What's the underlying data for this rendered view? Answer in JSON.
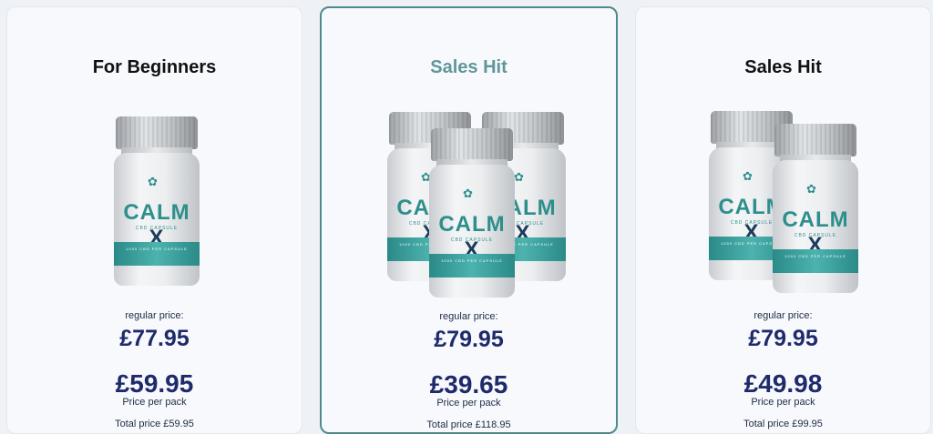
{
  "cards": [
    {
      "title": "For Beginners",
      "bottle_count": 1,
      "bottle": {
        "brand": "CALM",
        "brand_mark": "X",
        "subtitle": "CBD CAPSULE",
        "band_text": "1000 CBD PER CAPSULE"
      },
      "regular_label": "regular price:",
      "old_price": "£77.95",
      "new_price": "£59.95",
      "per_pack_label": "Price per pack",
      "total_label": "Total price £59.95"
    },
    {
      "title": "Sales Hit",
      "bottle_count": 3,
      "bottle": {
        "brand": "CALM",
        "brand_mark": "X",
        "subtitle": "CBD CAPSULE",
        "band_text": "1000 CBD PER CAPSULE"
      },
      "regular_label": "regular price:",
      "old_price": "£79.95",
      "new_price": "£39.65",
      "per_pack_label": "Price per pack",
      "total_label": "Total price £118.95"
    },
    {
      "title": "Sales Hit",
      "bottle_count": 2,
      "bottle": {
        "brand": "CALM",
        "brand_mark": "X",
        "subtitle": "CBD CAPSULE",
        "band_text": "1000 CBD PER CAPSULE"
      },
      "regular_label": "regular price:",
      "old_price": "£79.95",
      "new_price": "£49.98",
      "per_pack_label": "Price per pack",
      "total_label": "Total price £99.95"
    }
  ],
  "colors": {
    "accent_teal": "#4f8a8b",
    "price_navy": "#1f2a6b",
    "strike_red": "#d8332f"
  }
}
